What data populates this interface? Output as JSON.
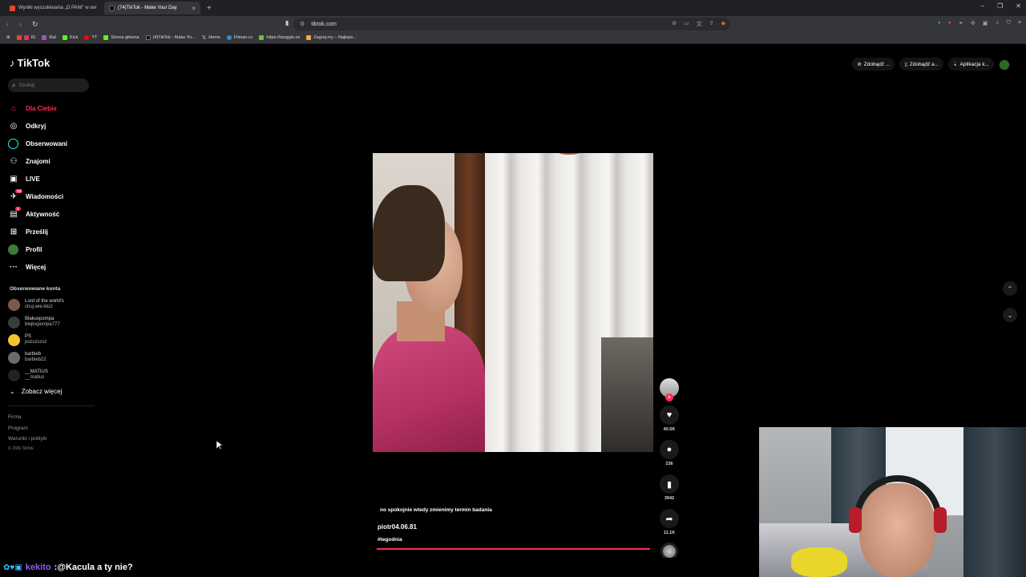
{
  "browser": {
    "tabs": [
      {
        "label": "Wyniki wyszukiwania „O PANI\" w ser",
        "active": false
      },
      {
        "label": "(74)TikTok - Make Your Day",
        "active": true
      }
    ],
    "url": "tiktok.com",
    "bookmarks": [
      {
        "label": "IG",
        "color": "#e1306c"
      },
      {
        "label": "Rat",
        "color": "#9b59b6"
      },
      {
        "label": "Kick",
        "color": "#53fc18"
      },
      {
        "label": "YT",
        "color": "#ff0000"
      },
      {
        "label": "Strona główna",
        "color": "#53fc18"
      },
      {
        "label": "(4)TikTok - Make Yo...",
        "color": "#111111"
      },
      {
        "label": "Home",
        "color": "#ffffff"
      },
      {
        "label": "Filman.cc",
        "color": "#2c8fd6"
      },
      {
        "label": "https://tanggle.io/",
        "color": "#6fbf3a"
      },
      {
        "label": "Zagraj.my – Najleps...",
        "color": "#f2a93b"
      }
    ]
  },
  "tiktok": {
    "logo": "TikTok",
    "search_placeholder": "Szukaj",
    "nav": [
      {
        "label": "Dla Ciebie",
        "icon": "home-icon",
        "active": true
      },
      {
        "label": "Odkryj",
        "icon": "compass-icon"
      },
      {
        "label": "Obserwowani",
        "icon": "following-icon"
      },
      {
        "label": "Znajomi",
        "icon": "friends-icon"
      },
      {
        "label": "LIVE",
        "icon": "live-icon"
      },
      {
        "label": "Wiadomości",
        "icon": "messages-icon",
        "badge": "74"
      },
      {
        "label": "Aktywność",
        "icon": "activity-icon",
        "badge": "1"
      },
      {
        "label": "Prześlij",
        "icon": "upload-icon"
      },
      {
        "label": "Profil",
        "icon": "profile-icon"
      },
      {
        "label": "Więcej",
        "icon": "more-icon"
      }
    ],
    "followed_title": "Obserwowane konta",
    "followed": [
      {
        "name": "Lord of the world's",
        "handle": "chuj.wie.kto2"
      },
      {
        "name": "Blakuxpompa",
        "handle": "blejkxpompa777"
      },
      {
        "name": "PS",
        "handle": "pszszszsz"
      },
      {
        "name": "barbieb",
        "handle": "barbieb22"
      },
      {
        "name": "__MATIUS",
        "handle": "__matius"
      }
    ],
    "see_more": "Zobacz więcej",
    "footer": [
      "Firma",
      "Program",
      "Warunki i polityki"
    ],
    "copyright": "© 2026 TikTok",
    "top_buttons": [
      "Zdobądź ...",
      "Zdobądź a...",
      "Aplikacja k..."
    ],
    "video": {
      "caption": "no spokojnie wtedy zmienimy termin badania",
      "author": "piotr04.06.81",
      "hashtag": "#tegodnia",
      "likes": "40.5K",
      "comments": "236",
      "saves": "3942",
      "shares": "11.1K"
    }
  },
  "chat": {
    "user": "kekito",
    "message": ":@Kacula a ty nie?"
  }
}
